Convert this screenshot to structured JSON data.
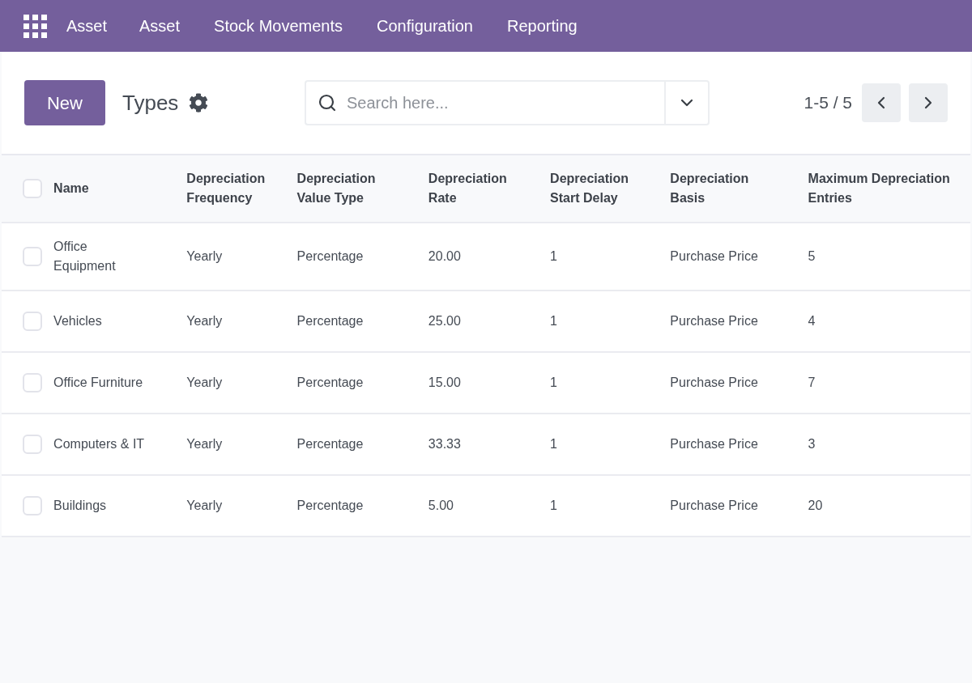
{
  "navbar": {
    "app_name": "Asset",
    "menu": [
      {
        "label": "Asset"
      },
      {
        "label": "Stock Movements"
      },
      {
        "label": "Configuration"
      },
      {
        "label": "Reporting"
      }
    ]
  },
  "control_panel": {
    "new_button": "New",
    "title": "Types",
    "search": {
      "placeholder": "Search here..."
    },
    "pager": "1-5 / 5"
  },
  "table": {
    "select_all": {
      "checked": false
    },
    "columns": [
      "Name",
      "Depreciation Frequency",
      "Depreciation Value Type",
      "Depreciation Rate",
      "Depreciation Start Delay",
      "Depreciation Basis",
      "Maximum Depreciation Entries"
    ],
    "rows": [
      {
        "checked": false,
        "cells": [
          "Office Equipment",
          "Yearly",
          "Percentage",
          "20.00",
          "1",
          "Purchase Price",
          "5"
        ]
      },
      {
        "checked": false,
        "cells": [
          "Vehicles",
          "Yearly",
          "Percentage",
          "25.00",
          "1",
          "Purchase Price",
          "4"
        ]
      },
      {
        "checked": false,
        "cells": [
          "Office Furniture",
          "Yearly",
          "Percentage",
          "15.00",
          "1",
          "Purchase Price",
          "7"
        ]
      },
      {
        "checked": false,
        "cells": [
          "Computers & IT",
          "Yearly",
          "Percentage",
          "33.33",
          "1",
          "Purchase Price",
          "3"
        ]
      },
      {
        "checked": false,
        "cells": [
          "Buildings",
          "Yearly",
          "Percentage",
          "5.00",
          "1",
          "Purchase Price",
          "20"
        ]
      }
    ]
  }
}
